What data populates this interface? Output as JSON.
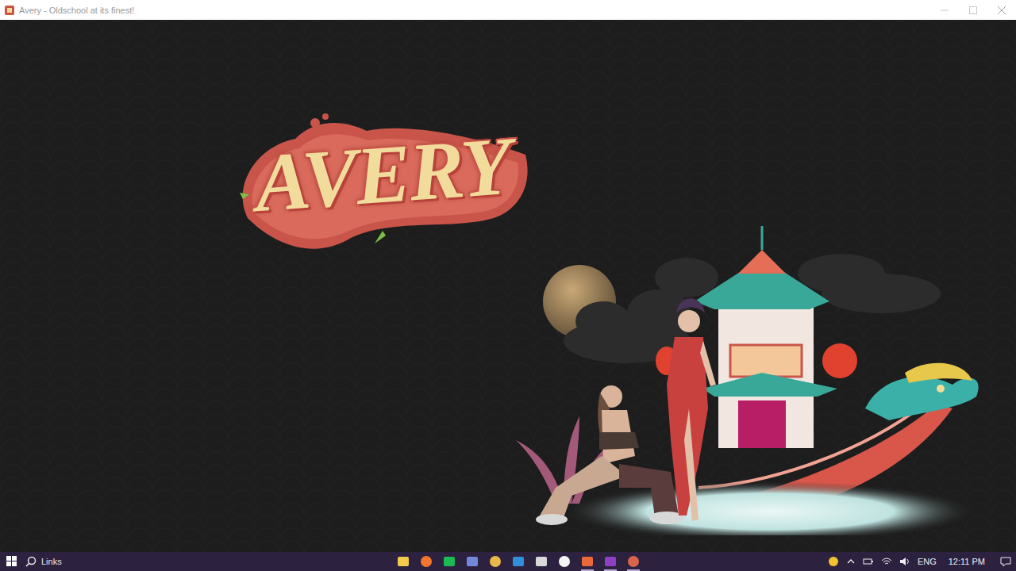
{
  "window": {
    "title": "Avery - Oldschool at its finest!"
  },
  "logo": {
    "text": "AVERY"
  },
  "taskbar": {
    "search": "Links",
    "apps": [
      {
        "color": "#f2c94c",
        "running": false
      },
      {
        "color": "#f2762e",
        "running": false
      },
      {
        "color": "#1db954",
        "running": false
      },
      {
        "color": "#7289da",
        "running": false
      },
      {
        "color": "#e9b949",
        "running": false
      },
      {
        "color": "#2f8fd8",
        "running": false
      },
      {
        "color": "#d8d8d8",
        "running": false
      },
      {
        "color": "#f4f4f4",
        "running": false
      },
      {
        "color": "#e86a3a",
        "running": true
      },
      {
        "color": "#8f3fc2",
        "running": true
      },
      {
        "color": "#d9644a",
        "running": true
      }
    ],
    "tray": {
      "language": "ENG",
      "time": "12:11 PM"
    }
  }
}
